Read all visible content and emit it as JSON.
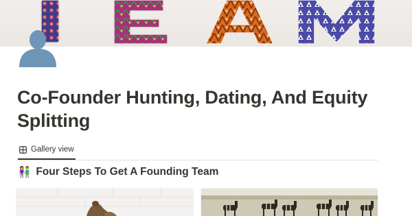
{
  "cover": {
    "image_text": "TEAM",
    "icon": "team-letters-cover-image"
  },
  "page_icon": "person-silhouette-icon",
  "page": {
    "title": "Co-Founder Hunting, Dating, And Equity Splitting"
  },
  "views": {
    "tabs": [
      {
        "label": "Gallery view",
        "icon": "gallery-grid-icon",
        "active": true
      }
    ]
  },
  "section": {
    "emoji": "👫",
    "heading": "Four Steps To Get A Founding Team"
  },
  "gallery": {
    "cards": [
      {
        "icon": "card-cover-sculpture-image"
      },
      {
        "icon": "card-cover-zebras-image"
      }
    ]
  },
  "colors": {
    "text": "#37352f",
    "divider": "#e3e2e0",
    "avatar": "#6f95b7"
  }
}
